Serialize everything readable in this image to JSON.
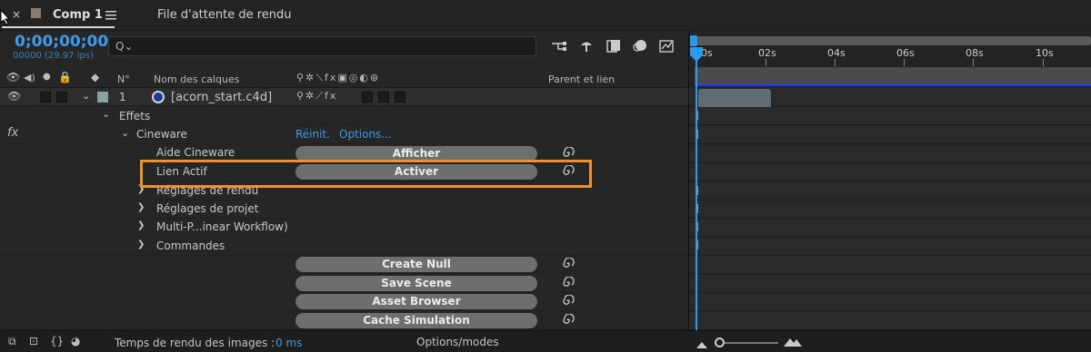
{
  "tabs": {
    "close": "×",
    "comp_label": "Comp 1",
    "menu_icon": "hamburger-menu-icon",
    "render_queue": "File d'attente de rendu"
  },
  "time": {
    "timecode": "0;00;00;00",
    "frames": "00000 (29.97 ips)",
    "search_placeholder": "Q⌄"
  },
  "columns": {
    "num": "N°",
    "layer_names": "Nom des calques",
    "parent": "Parent et lien"
  },
  "layer": {
    "index": "1",
    "name": "[acorn_start.c4d]"
  },
  "effects": {
    "effets": "Effets",
    "fx": "fx",
    "cineware": "Cineware",
    "reset": "Réinit.",
    "options": "Options..."
  },
  "properties": [
    {
      "label": "Aide Cineware",
      "button": "Afficher"
    },
    {
      "label": "Lien Actif",
      "button": "Activer"
    }
  ],
  "groups": [
    "Réglages de rendu",
    "Réglages de projet",
    "Multi-P...inear Workflow)",
    "Commandes"
  ],
  "commands": [
    "Create Null",
    "Save Scene",
    "Asset Browser",
    "Cache Simulation"
  ],
  "ruler": [
    "0s",
    "02s",
    "04s",
    "06s",
    "08s",
    "10s"
  ],
  "status": {
    "render_label": "Temps de rendu des images :",
    "render_value": "0 ms",
    "options": "Options/modes"
  },
  "colors": {
    "accent": "#2a9bf0",
    "highlight": "#f0922b",
    "link": "#3f9be6"
  }
}
